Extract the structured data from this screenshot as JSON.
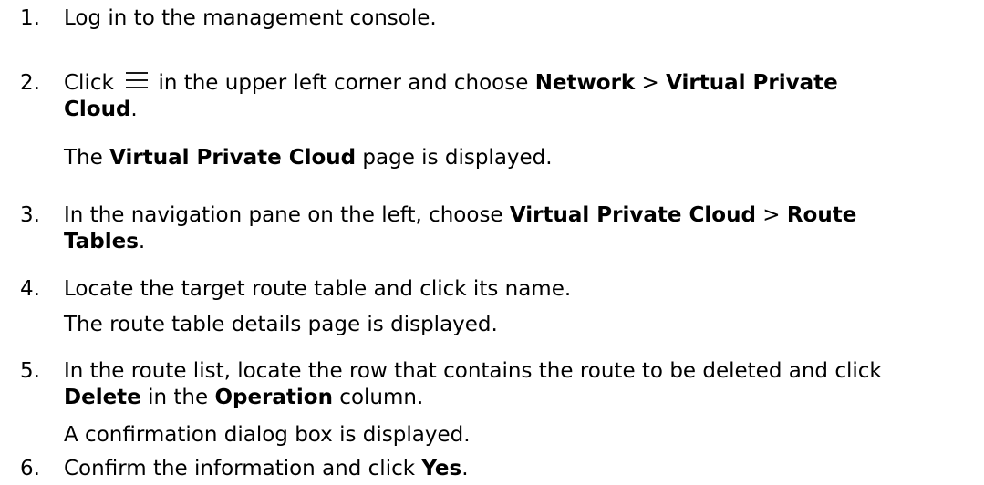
{
  "steps": [
    {
      "number": "1.",
      "text": "Log in to the management console."
    },
    {
      "number": "2.",
      "pre": "Click",
      "icon": "menu-icon",
      "mid": " in the upper left corner and choose ",
      "b1": "Network",
      "sep": " > ",
      "b2_line1": "Virtual Private",
      "b2_line2": "Cloud",
      "end": ".",
      "sub_pre": "The ",
      "sub_b": "Virtual Private Cloud",
      "sub_post": " page is displayed."
    },
    {
      "number": "3.",
      "pre": "In the navigation pane on the left, choose ",
      "b1": "Virtual Private Cloud",
      "sep": " > ",
      "b2_line1": "Route",
      "b2_line2": "Tables",
      "end": "."
    },
    {
      "number": "4.",
      "text": "Locate the target route table and click its name.",
      "sub": "The route table details page is displayed."
    },
    {
      "number": "5.",
      "pre": "In the route list, locate the row that contains the route to be deleted and click",
      "b1": "Delete",
      "mid": " in the ",
      "b2": "Operation",
      "end": " column.",
      "sub": "A confirmation dialog box is displayed."
    },
    {
      "number": "6.",
      "pre": "Confirm the information and click ",
      "b1": "Yes",
      "end": "."
    }
  ]
}
